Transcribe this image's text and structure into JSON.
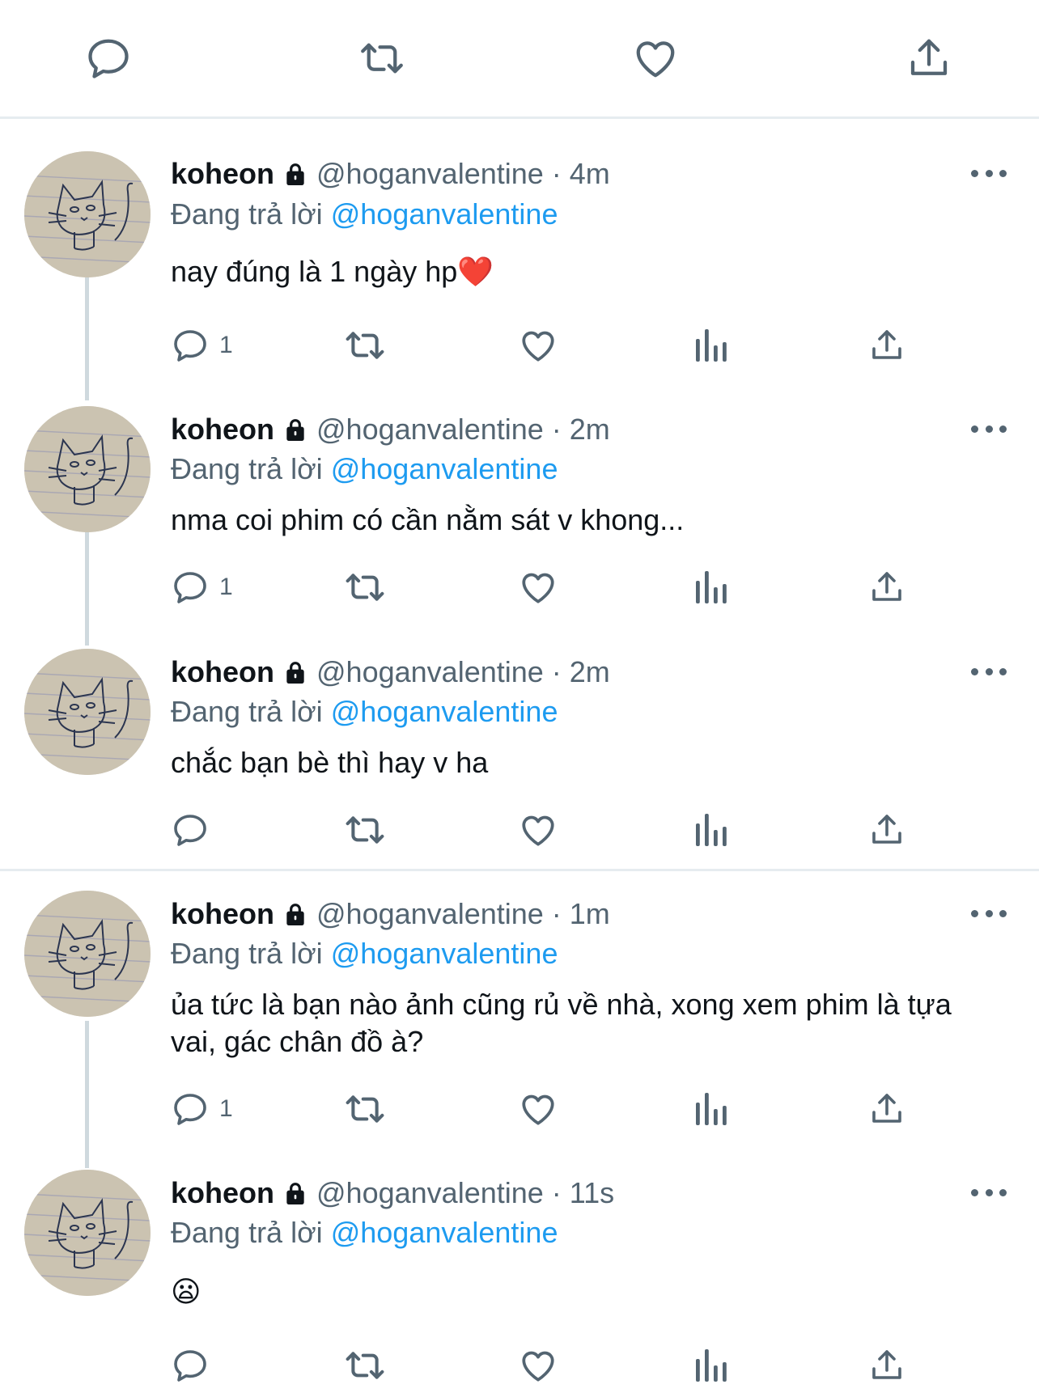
{
  "top_actions": {
    "icons": [
      "reply-icon",
      "retweet-icon",
      "like-icon",
      "share-icon"
    ]
  },
  "colors": {
    "accent": "#1d9bf0",
    "text_primary": "#0f1419",
    "text_secondary": "#536471",
    "divider": "#e6ecf0"
  },
  "tweets": [
    {
      "name": "koheon",
      "handle_time": "@hoganvalentine · 4m",
      "replying_prefix": "Đang trả lời",
      "replying_to": "@hoganvalentine",
      "text": "nay đúng là 1 ngày hp❤️",
      "reply_count": "1"
    },
    {
      "name": "koheon",
      "handle_time": "@hoganvalentine · 2m",
      "replying_prefix": "Đang trả lời",
      "replying_to": "@hoganvalentine",
      "text": "nma coi phim có cần nằm sát v khong...",
      "reply_count": "1"
    },
    {
      "name": "koheon",
      "handle_time": "@hoganvalentine · 2m",
      "replying_prefix": "Đang trả lời",
      "replying_to": "@hoganvalentine",
      "text": "chắc bạn bè thì hay v ha",
      "reply_count": ""
    },
    {
      "name": "koheon",
      "handle_time": "@hoganvalentine · 1m",
      "replying_prefix": "Đang trả lời",
      "replying_to": "@hoganvalentine",
      "text": "ủa tức là bạn nào ảnh cũng rủ về nhà, xong xem phim là tựa vai, gác chân đồ à?",
      "reply_count": "1"
    },
    {
      "name": "koheon",
      "handle_time": "@hoganvalentine · 11s",
      "replying_prefix": "Đang trả lời",
      "replying_to": "@hoganvalentine",
      "text": "😦",
      "reply_count": ""
    }
  ]
}
